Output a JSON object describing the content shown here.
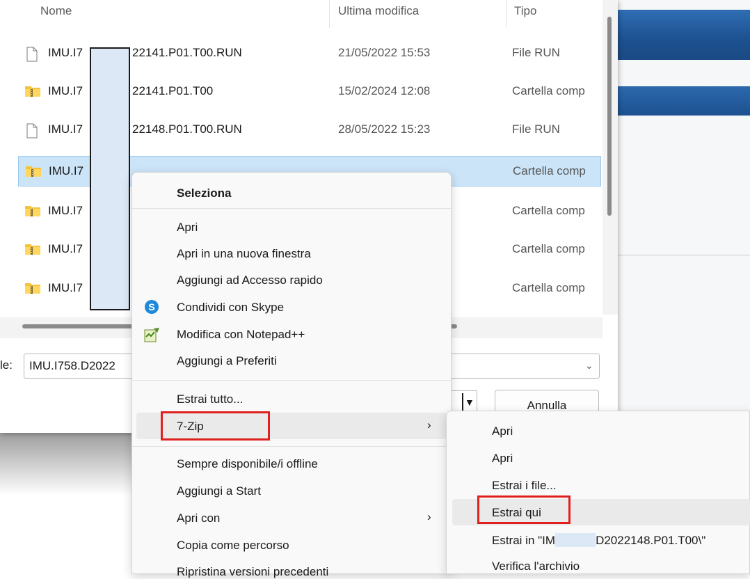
{
  "columns": {
    "name": "Nome",
    "modified": "Ultima modifica",
    "type": "Tipo"
  },
  "files": [
    {
      "name": "IMU.I7",
      "name_tail": "22141.P01.T00.RUN",
      "date": "21/05/2022 15:53",
      "type": "File RUN",
      "icon": "file-icon"
    },
    {
      "name": "IMU.I7",
      "name_tail": "22141.P01.T00",
      "date": "15/02/2024 12:08",
      "type": "Cartella comp",
      "icon": "zip-folder-icon"
    },
    {
      "name": "IMU.I7",
      "name_tail": "22148.P01.T00.RUN",
      "date": "28/05/2022 15:23",
      "type": "File RUN",
      "icon": "file-icon"
    },
    {
      "name": "IMU.I7",
      "name_tail": "",
      "date": "",
      "type": "Cartella comp",
      "icon": "zip-folder-icon"
    },
    {
      "name": "IMU.I7",
      "name_tail": "",
      "date": "",
      "type": "Cartella comp",
      "icon": "zip-folder-icon"
    },
    {
      "name": "IMU.I7",
      "name_tail": "",
      "date": "",
      "type": "Cartella comp",
      "icon": "zip-folder-icon"
    },
    {
      "name": "IMU.I7",
      "name_tail": "",
      "date": "",
      "type": "Cartella comp",
      "icon": "zip-folder-icon"
    }
  ],
  "filename": {
    "label": "le:",
    "value": "IMU.I758.D2022"
  },
  "buttons": {
    "cancel": "Annulla"
  },
  "context_menu": {
    "header": "Seleziona",
    "items": {
      "open": "Apri",
      "open_new_window": "Apri in una nuova finestra",
      "quick_access": "Aggiungi ad Accesso rapido",
      "share_skype": "Condividi con Skype",
      "notepad": "Modifica con Notepad++",
      "favorites": "Aggiungi a Preferiti",
      "extract_all": "Estrai tutto...",
      "seven_zip": "7-Zip",
      "offline": "Sempre disponibile/i offline",
      "add_start": "Aggiungi a Start",
      "open_with": "Apri con",
      "copy_path": "Copia come percorso",
      "restore": "Ripristina versioni precedenti"
    }
  },
  "submenu": {
    "open1": "Apri",
    "open2": "Apri",
    "extract_files": "Estrai i file...",
    "extract_here": "Estrai qui",
    "extract_to_prefix": "Estrai in \"IM",
    "extract_to_suffix": "D2022148.P01.T00\\\"",
    "test_archive": "Verifica l'archivio"
  },
  "colors": {
    "highlight_red": "#e0201f",
    "selection": "#cce4f7",
    "accent_blue": "#1f5c9c"
  }
}
